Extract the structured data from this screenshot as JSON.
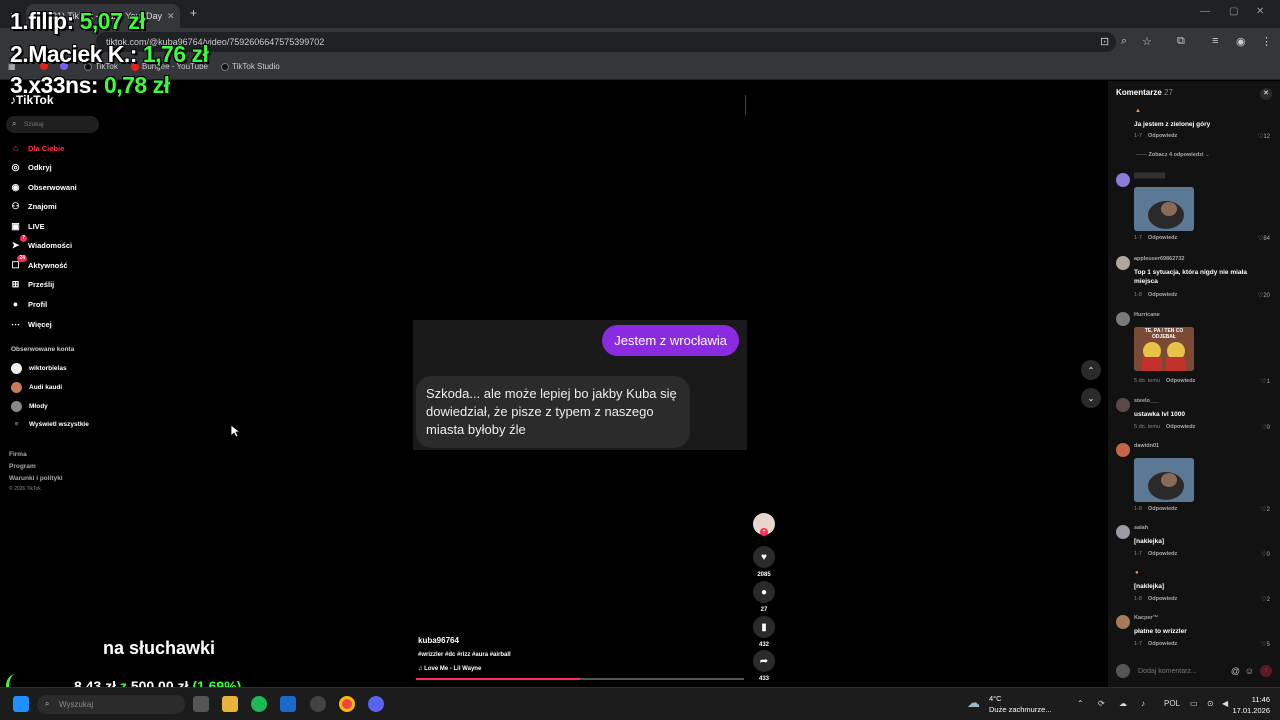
{
  "browser": {
    "tab_title": "(31) TikTok - Make Your Day",
    "url": "tiktok.com/@kuba96764/video/7592606647575399702",
    "bookmarks": [
      "TikTok",
      "Bungee - YouTube",
      "TikTok Studio"
    ]
  },
  "overlay": {
    "leaderboard": [
      {
        "rank": "1.",
        "name": "filip:",
        "amount": "5,07 zł"
      },
      {
        "rank": "2.",
        "name": "Maciek K.:",
        "amount": "1,76 zł"
      },
      {
        "rank": "3.",
        "name": "x33ns:",
        "amount": "0,78 zł"
      }
    ],
    "caption": "na słuchawki",
    "donation_progress": "8,43 zł",
    "donation_sep": "z",
    "donation_goal": "500,00 zł",
    "donation_percent": "(1.69%)",
    "donation_fraction": 0.0169
  },
  "sidebar": {
    "logo": "TikTok",
    "search_placeholder": "Szukaj",
    "nav": [
      {
        "label": "Dla Ciebie",
        "icon": "home-icon"
      },
      {
        "label": "Odkryj",
        "icon": "compass-icon"
      },
      {
        "label": "Obserwowani",
        "icon": "following-icon"
      },
      {
        "label": "Znajomi",
        "icon": "friends-icon"
      },
      {
        "label": "LIVE",
        "icon": "live-icon"
      },
      {
        "label": "Wiadomości",
        "icon": "messages-icon",
        "badge": "7"
      },
      {
        "label": "Aktywność",
        "icon": "activity-icon",
        "badge": "24"
      },
      {
        "label": "Prześlij",
        "icon": "upload-icon"
      },
      {
        "label": "Profil",
        "icon": "profile-icon"
      },
      {
        "label": "Więcej",
        "icon": "more-icon"
      }
    ],
    "followed_heading": "Obserwowane konta",
    "followed": [
      "wiktorbielas",
      "Audi kaudi",
      "Młody"
    ],
    "show_all": "Wyświetl wszystkie",
    "footer": [
      "Firma",
      "Program",
      "Warunki i polityki"
    ],
    "copyright": "© 2026 TikTok"
  },
  "video": {
    "chat_me": "Jestem z wrocławia",
    "chat_other": "Szkoda... ale może lepiej bo jakby Kuba się dowiedział, że pisze z typem z naszego miasta byłoby źle",
    "author": "kuba96764",
    "hashtags": "#wrizzler #dc #rizz #aura #airball",
    "music": "Love Me - Lil Wayne",
    "progress": 0.5
  },
  "actions": {
    "likes": "2085",
    "comments": "27",
    "saves": "432",
    "shares": "433"
  },
  "comments": {
    "title": "Komentarze",
    "count": "27",
    "reply_label": "Odpowiedz",
    "input_placeholder": "Dodaj komentarz...",
    "items": [
      {
        "user": "",
        "text": "Ja jestem z zielonej góry",
        "date": "1-7",
        "likes": "12",
        "view_replies": "Zobacz 4 odpowiedzi"
      },
      {
        "user": "",
        "text": "",
        "date": "1-7",
        "likes": "84"
      },
      {
        "user": "appleuser69862732",
        "text": "Top 1 sytuacja, która nigdy nie miała miejsca",
        "date": "1-8",
        "likes": "20"
      },
      {
        "user": "Hurricane",
        "text": "",
        "date": "5 dn. temu",
        "likes": "1",
        "meme": "TE, PA / TEN CO ODJEBAŁ"
      },
      {
        "user": "steelo___",
        "text": "ustawka lvl 1000",
        "date": "5 dn. temu",
        "likes": "0"
      },
      {
        "user": "dawidn01",
        "text": "",
        "date": "1-8",
        "likes": "2"
      },
      {
        "user": "salah",
        "text": "[naklejka]",
        "date": "1-7",
        "likes": "0"
      },
      {
        "user": "",
        "text": "[naklejka]",
        "date": "1-8",
        "likes": "2"
      },
      {
        "user": "Kacper™",
        "text": "płatne to wrizzler",
        "date": "1-7",
        "likes": "5"
      }
    ]
  },
  "taskbar": {
    "search_placeholder": "Wyszukaj",
    "weather_temp": "4°C",
    "weather_desc": "Duże zachmurze...",
    "language": "POL",
    "time": "11:46",
    "date": "17.01.2026"
  },
  "colors": {
    "accent": "#fe2c55",
    "bubble": "#8a2be2",
    "overlay_money": "#3cff3c"
  }
}
